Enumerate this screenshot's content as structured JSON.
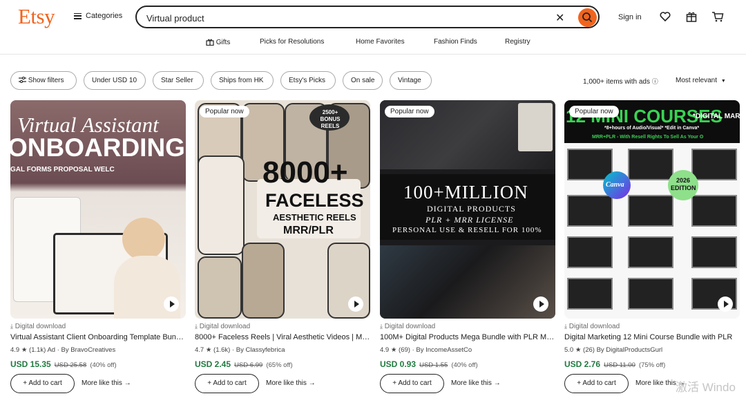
{
  "header": {
    "logo": "Etsy",
    "categories_label": "Categories",
    "search": {
      "value": "Virtual product",
      "placeholder": "Search for anything"
    },
    "sign_in": "Sign in",
    "accent_color": "#f1641e"
  },
  "nav": [
    "Gifts",
    "Picks for Resolutions",
    "Home Favorites",
    "Fashion Finds",
    "Registry"
  ],
  "filters": {
    "chips": [
      "Show filters",
      "Under USD 10",
      "Star Seller",
      "Ships from HK",
      "Etsy's Picks",
      "On sale",
      "Vintage"
    ],
    "results_count": "1,000+ items with ads",
    "sort_label": "Most relevant"
  },
  "products": [
    {
      "badge": "",
      "image_text": [
        "Virtual Assistant",
        "ONBOARDING",
        "GAL  FORMS  PROPOSAL  WELC"
      ],
      "type": "Digital download",
      "title": "Virtual Assistant Client Onboarding Template Bundle",
      "rating": "4.9",
      "reviews": "(1.1k)",
      "ad": "Ad",
      "shop": "By BravoCreatives",
      "price": "USD 15.35",
      "original_price": "USD 25.58",
      "discount": "(40% off)",
      "add_to_cart": "Add to cart",
      "more_like_this": "More like this"
    },
    {
      "badge": "Popular now",
      "image_text": [
        "2500+ BONUS REELS",
        "8000+",
        "FACELESS",
        "AESTHETIC REELS",
        "MRR/PLR"
      ],
      "type": "Digital download",
      "title": "8000+ Faceless Reels | Viral Aesthetic Videos | MRR",
      "rating": "4.7",
      "reviews": "(1.6k)",
      "ad": "",
      "shop": "By Classyfebrica",
      "price": "USD 2.45",
      "original_price": "USD 6.99",
      "discount": "(65% off)",
      "add_to_cart": "Add to cart",
      "more_like_this": "More like this"
    },
    {
      "badge": "Popular now",
      "image_text": [
        "100+MILLION",
        "DIGITAL PRODUCTS",
        "PLR + MRR LICENSE",
        "PERSONAL USE & RESELL FOR 100%"
      ],
      "type": "Digital download",
      "title": "100M+ Digital Products Mega Bundle with PLR MRR",
      "rating": "4.9",
      "reviews": "(69)",
      "ad": "",
      "shop": "By IncomeAssetCo",
      "price": "USD 0.93",
      "original_price": "USD 1.55",
      "discount": "(40% off)",
      "add_to_cart": "Add to cart",
      "more_like_this": "More like this"
    },
    {
      "badge": "Popular now",
      "image_text": [
        "12 MINI COURSES",
        "*DIGITAL MARKETIN",
        "*8+hours of Audio/Visual*  *Edit in Canva*",
        "MRR+PLR - With Resell Rights To Sell As Your O",
        "2026 EDITION",
        "Canva"
      ],
      "type": "Digital download",
      "title": "Digital Marketing 12 Mini Course Bundle with PLR",
      "rating": "5.0",
      "reviews": "(26)",
      "ad": "",
      "shop": "By DigitalProductsGurl",
      "price": "USD 2.76",
      "original_price": "USD 11.00",
      "discount": "(75% off)",
      "add_to_cart": "Add to cart",
      "more_like_this": "More like this"
    }
  ],
  "watermarks": [
    "激活 Windo"
  ]
}
